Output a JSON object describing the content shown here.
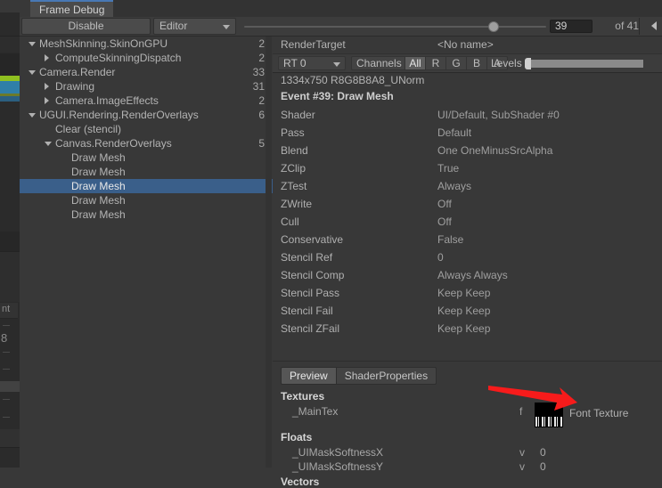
{
  "window": {
    "tab_label": "Frame Debug",
    "toolbar": {
      "disable_label": "Disable",
      "target_dropdown": "Editor",
      "frame_index": "39",
      "frame_total_label": "of 41",
      "prev_button_icon": "triangle-left-icon"
    }
  },
  "tree": {
    "items": [
      {
        "label": "MeshSkinning.SkinOnGPU",
        "count": "2",
        "depth": 0,
        "toggle": "down",
        "selected": false
      },
      {
        "label": "ComputeSkinningDispatch",
        "count": "2",
        "depth": 1,
        "toggle": "right",
        "selected": false
      },
      {
        "label": "Camera.Render",
        "count": "33",
        "depth": 0,
        "toggle": "down",
        "selected": false
      },
      {
        "label": "Drawing",
        "count": "31",
        "depth": 1,
        "toggle": "right",
        "selected": false
      },
      {
        "label": "Camera.ImageEffects",
        "count": "2",
        "depth": 1,
        "toggle": "right",
        "selected": false
      },
      {
        "label": "UGUI.Rendering.RenderOverlays",
        "count": "6",
        "depth": 0,
        "toggle": "down",
        "selected": false
      },
      {
        "label": "Clear (stencil)",
        "count": "",
        "depth": 1,
        "toggle": "none",
        "selected": false
      },
      {
        "label": "Canvas.RenderOverlays",
        "count": "5",
        "depth": 1,
        "toggle": "down",
        "selected": false
      },
      {
        "label": "Draw Mesh",
        "count": "",
        "depth": 2,
        "toggle": "none",
        "selected": false
      },
      {
        "label": "Draw Mesh",
        "count": "",
        "depth": 2,
        "toggle": "none",
        "selected": false
      },
      {
        "label": "Draw Mesh",
        "count": "",
        "depth": 2,
        "toggle": "none",
        "selected": true
      },
      {
        "label": "Draw Mesh",
        "count": "",
        "depth": 2,
        "toggle": "none",
        "selected": false
      },
      {
        "label": "Draw Mesh",
        "count": "",
        "depth": 2,
        "toggle": "none",
        "selected": false
      }
    ]
  },
  "details": {
    "render_target_label": "RenderTarget",
    "render_target_value": "<No name>",
    "rt_dropdown": "RT 0",
    "channels_label": "Channels",
    "channels": [
      {
        "label": "All",
        "active": true
      },
      {
        "label": "R",
        "active": false
      },
      {
        "label": "G",
        "active": false
      },
      {
        "label": "B",
        "active": false
      },
      {
        "label": "A",
        "active": false
      }
    ],
    "levels_label": "Levels",
    "format_line": "1334x750 R8G8B8A8_UNorm",
    "event_line": "Event #39: Draw Mesh",
    "properties": [
      {
        "key": "Shader",
        "value": "UI/Default, SubShader #0"
      },
      {
        "key": "Pass",
        "value": "Default"
      },
      {
        "key": "Blend",
        "value": "One OneMinusSrcAlpha"
      },
      {
        "key": "ZClip",
        "value": "True"
      },
      {
        "key": "ZTest",
        "value": "Always"
      },
      {
        "key": "ZWrite",
        "value": "Off"
      },
      {
        "key": "Cull",
        "value": "Off"
      },
      {
        "key": "Conservative",
        "value": "False"
      },
      {
        "key": "Stencil Ref",
        "value": "0"
      },
      {
        "key": "Stencil Comp",
        "value": "Always Always"
      },
      {
        "key": "Stencil Pass",
        "value": "Keep Keep"
      },
      {
        "key": "Stencil Fail",
        "value": "Keep Keep"
      },
      {
        "key": "Stencil ZFail",
        "value": "Keep Keep"
      }
    ]
  },
  "bottom": {
    "tabs": [
      {
        "label": "Preview",
        "active": true
      },
      {
        "label": "ShaderProperties",
        "active": false
      }
    ],
    "sections": [
      {
        "title": "Textures",
        "rows": [
          {
            "name": "_MainTex",
            "flag": "f",
            "value": "",
            "thumb": true,
            "thumb_label": "Font Texture"
          }
        ]
      },
      {
        "title": "Floats",
        "rows": [
          {
            "name": "_UIMaskSoftnessX",
            "flag": "v",
            "value": "0",
            "thumb": false,
            "thumb_label": ""
          },
          {
            "name": "_UIMaskSoftnessY",
            "flag": "v",
            "value": "0",
            "thumb": false,
            "thumb_label": ""
          }
        ]
      },
      {
        "title": "Vectors",
        "rows": []
      }
    ]
  },
  "annotation": {
    "arrow_color": "#f71b1b",
    "arrow_name": "red-pointer-arrow"
  },
  "left_sliver": {
    "fragment_1": "nt",
    "fragment_2": "8"
  },
  "colors": {
    "background": "#383838",
    "panel": "#3c3c3c",
    "selection": "#3a5f8a",
    "tab_accent": "#4878b4",
    "profiler_marker": "#9acd1e"
  }
}
